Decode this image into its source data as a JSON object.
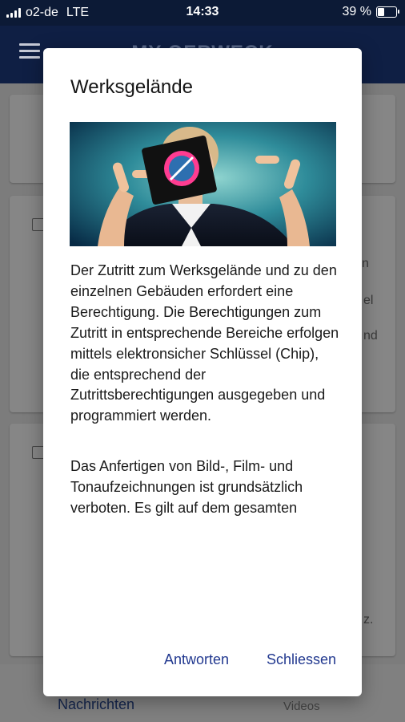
{
  "status_bar": {
    "carrier": "o2-de",
    "network": "LTE",
    "time": "14:33",
    "battery": "39 %",
    "battery_level": 0.39
  },
  "app_bar": {
    "title": "MY OERWECK"
  },
  "background": {
    "fragments": [
      "n",
      "el",
      "nd",
      "z."
    ],
    "nav_left": "Nachrichten",
    "nav_right": "Videos"
  },
  "dialog": {
    "title": "Werksgelände",
    "paragraphs": [
      "Der Zutritt zum Werksgelände und zu den einzelnen Gebäuden erfordert eine Berechtigung. Die Berechtigungen zum Zutritt in entsprechende Bereiche erfolgen mittels elektronsicher Schlüssel (Chip), die entsprechend der Zutrittsberechtigungen ausgegeben und programmiert werden.",
      "Das Anfertigen von Bild-, Film- und Tonaufzeichnungen ist grundsätzlich verboten. Es gilt auf dem gesamten"
    ],
    "buttons": {
      "answer": "Antworten",
      "close": "Schliessen"
    }
  },
  "colors": {
    "accent": "#21388f",
    "app_bar": "#0f1f44"
  }
}
